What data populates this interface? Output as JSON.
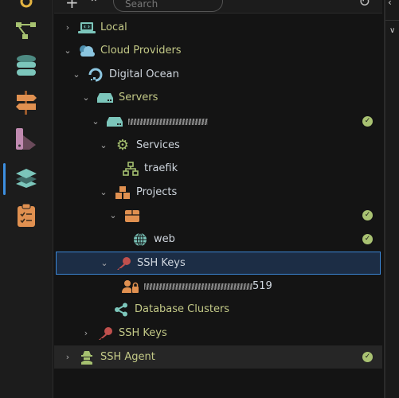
{
  "toolbar": {
    "add": "+",
    "collapse": "⌃",
    "search_placeholder": "Search",
    "refresh": "↻"
  },
  "activity": [
    "git-graph-icon",
    "database-icon",
    "signpost-icon",
    "palette-icon",
    "layers-icon",
    "checklist-icon"
  ],
  "tree": [
    {
      "label": "Local",
      "icon": "laptop-code-icon",
      "expanded": false
    },
    {
      "label": "Cloud Providers",
      "icon": "cloud-icon",
      "expanded": true
    },
    {
      "label": "Digital Ocean",
      "icon": "digitalocean-icon",
      "expanded": true
    },
    {
      "label": "Servers",
      "icon": "server-icon",
      "expanded": true
    },
    {
      "label": "",
      "icon": "server-icon",
      "expanded": true,
      "redacted": true,
      "status": "ok"
    },
    {
      "label": "Services",
      "icon": "gear-icon",
      "expanded": true
    },
    {
      "label": "traefik",
      "icon": "network-icon"
    },
    {
      "label": "Projects",
      "icon": "boxes-icon",
      "expanded": true
    },
    {
      "label": "",
      "icon": "box-icon",
      "expanded": true,
      "status": "ok"
    },
    {
      "label": "web",
      "icon": "globe-icon",
      "status": "ok"
    },
    {
      "label": "SSH Keys",
      "icon": "key-icon",
      "expanded": true,
      "selected": true
    },
    {
      "label": "519",
      "icon": "user-lock-icon",
      "redacted": true
    },
    {
      "label": "Database Clusters",
      "icon": "share-icon"
    },
    {
      "label": "SSH Keys",
      "icon": "key-icon",
      "expanded": false
    },
    {
      "label": "SSH Agent",
      "icon": "agent-icon",
      "expanded": false,
      "status": "ok"
    }
  ],
  "colors": {
    "selection": "#1c2d45",
    "selection_border": "#3b86d6",
    "status_ok": "#a9c272",
    "label_green": "#c3c987"
  }
}
